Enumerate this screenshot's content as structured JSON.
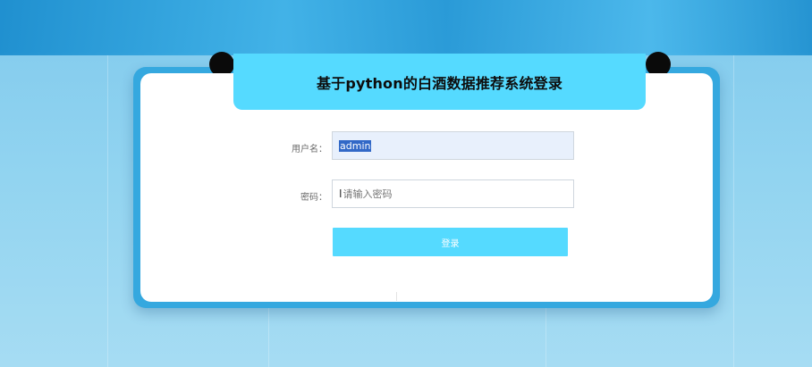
{
  "login_form": {
    "title": "基于python的白酒数据推荐系统登录",
    "username_label": "用户名：",
    "username_value": "admin",
    "password_label": "密码：",
    "password_placeholder": "请输入密码",
    "login_button_label": "登录"
  },
  "colors": {
    "accent": "#55daff",
    "frame": "#35a8df",
    "selection": "#3168c7"
  }
}
